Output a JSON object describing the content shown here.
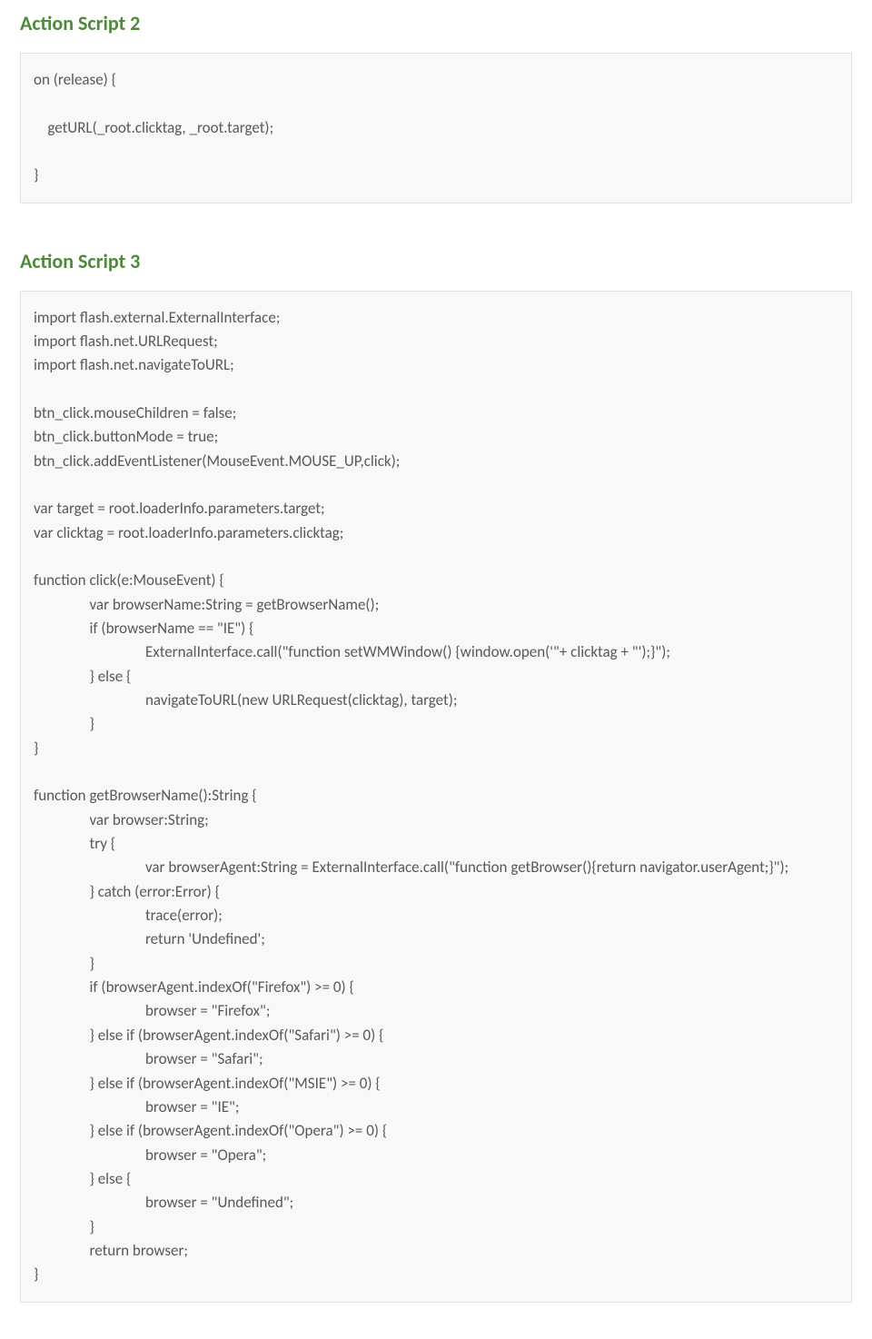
{
  "sections": [
    {
      "title": "Action Script 2",
      "code": "on (release) {\n\n    getURL(_root.clicktag, _root.target);\n\n}"
    },
    {
      "title": "Action Script 3",
      "code": "import flash.external.ExternalInterface;\nimport flash.net.URLRequest;\nimport flash.net.navigateToURL;\n\nbtn_click.mouseChildren = false;\nbtn_click.buttonMode = true;\nbtn_click.addEventListener(MouseEvent.MOUSE_UP,click);\n\nvar target = root.loaderInfo.parameters.target;\nvar clicktag = root.loaderInfo.parameters.clicktag;\n\nfunction click(e:MouseEvent) {\n                var browserName:String = getBrowserName();\n                if (browserName == \"IE\") {\n                                ExternalInterface.call(\"function setWMWindow() {window.open('\"+ clicktag + \"');}\");\n                } else {\n                                navigateToURL(new URLRequest(clicktag), target);\n                }\n}\n\nfunction getBrowserName():String {\n                var browser:String;\n                try {\n                                var browserAgent:String = ExternalInterface.call(\"function getBrowser(){return navigator.userAgent;}\");\n                } catch (error:Error) {\n                                trace(error);\n                                return 'Undefined';\n                }\n                if (browserAgent.indexOf(\"Firefox\") >= 0) {\n                                browser = \"Firefox\";\n                } else if (browserAgent.indexOf(\"Safari\") >= 0) {\n                                browser = \"Safari\";\n                } else if (browserAgent.indexOf(\"MSIE\") >= 0) {\n                                browser = \"IE\";\n                } else if (browserAgent.indexOf(\"Opera\") >= 0) {\n                                browser = \"Opera\";\n                } else {\n                                browser = \"Undefined\";\n                }\n                return browser;\n}"
    }
  ]
}
